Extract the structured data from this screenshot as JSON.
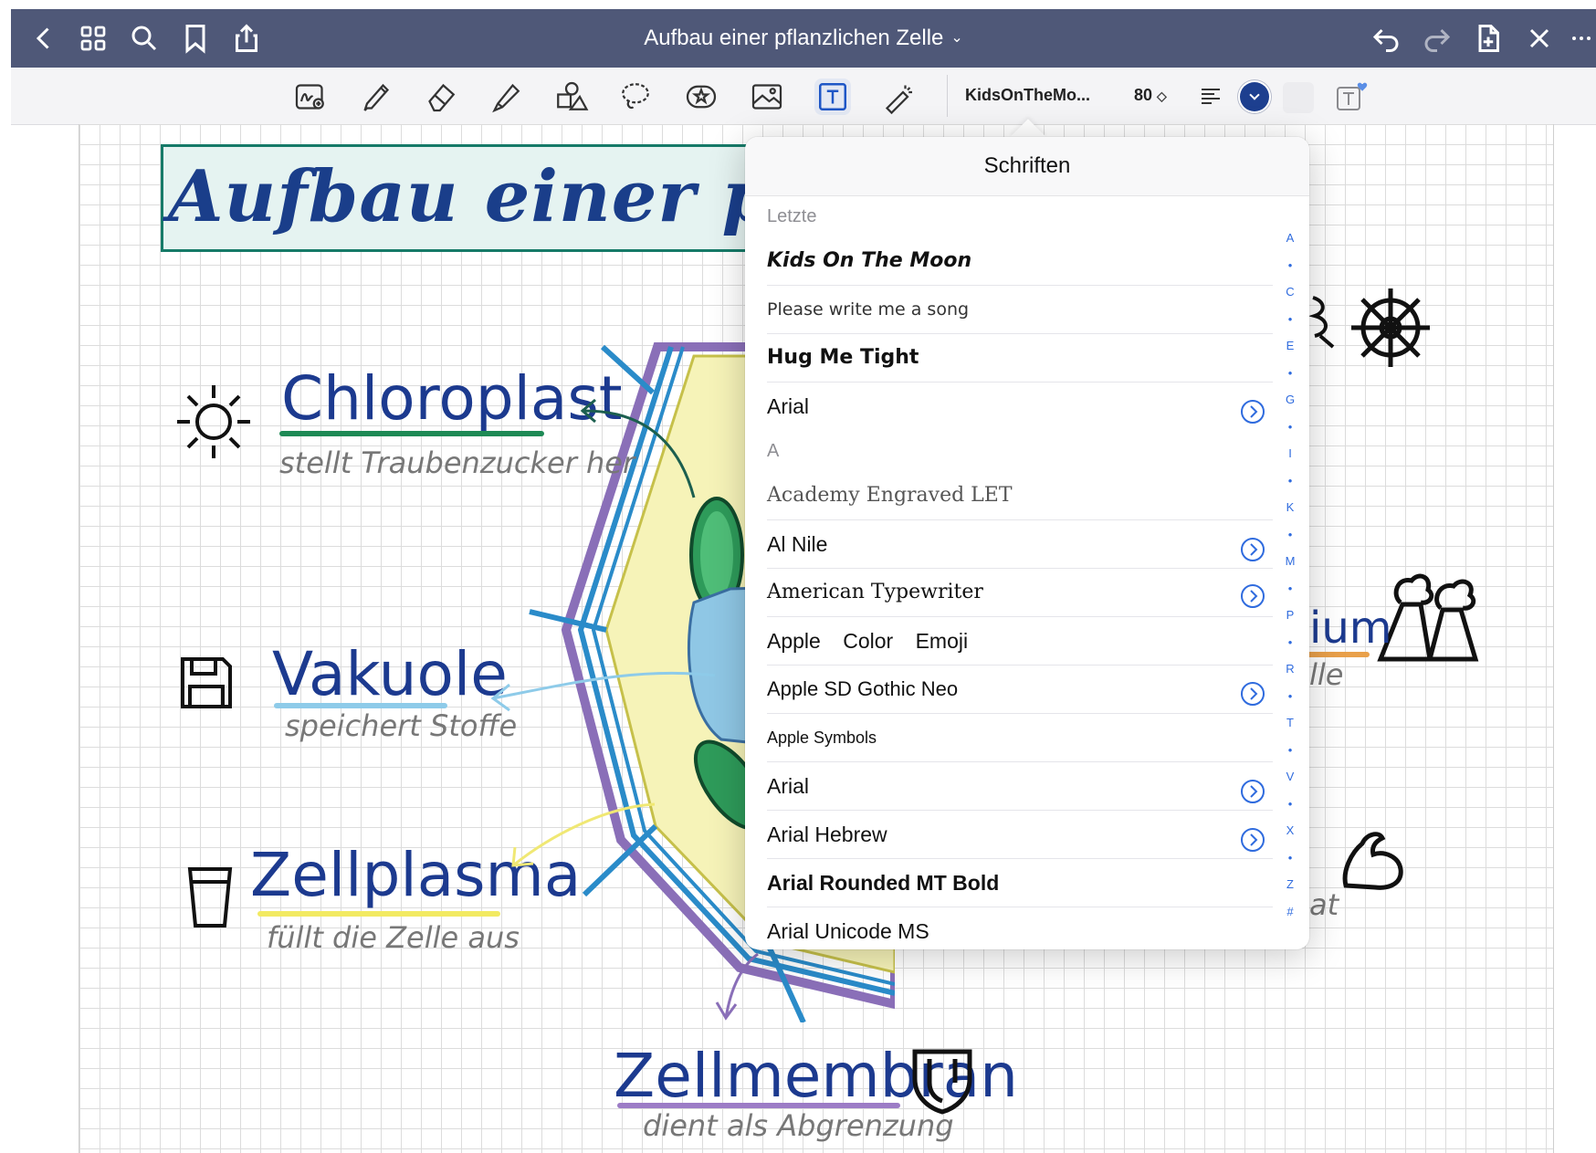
{
  "topbar": {
    "title": "Aufbau einer pflanzlichen Zelle",
    "title_chevron": "⌄",
    "left_icons": [
      "back-chevron-icon",
      "grid-icon",
      "search-icon",
      "bookmark-icon",
      "share-icon"
    ],
    "right_icons": [
      "undo-icon",
      "redo-icon",
      "add-page-icon",
      "close-icon",
      "more-icon"
    ]
  },
  "toolbar": {
    "tools": [
      "handwriting-zoom-icon",
      "pen-icon",
      "eraser-icon",
      "highlighter-icon",
      "shapes-icon",
      "lasso-icon",
      "elements-icon",
      "image-icon",
      "text-tool-icon",
      "laser-pointer-icon"
    ],
    "font_name": "KidsOnTheMo...",
    "font_size": "80",
    "size_stepper": "◇",
    "color": "#1d3f8f"
  },
  "canvas": {
    "note_title": "Aufbau einer pfla",
    "labels": [
      {
        "title": "Chloroplast",
        "subtitle": "stellt Traubenzucker her"
      },
      {
        "title": "Vakuole",
        "subtitle": "speichert Stoffe"
      },
      {
        "title": "Zellplasma",
        "subtitle": "füllt die Zelle aus"
      },
      {
        "title": "Zellmembran",
        "subtitle": "dient als Abgrenzung"
      }
    ],
    "partial_right": [
      "ium",
      "lle",
      "at"
    ]
  },
  "font_picker": {
    "title": "Schriften",
    "recent_header": "Letzte",
    "recent": [
      {
        "name": "Kids On The Moon",
        "info": false
      },
      {
        "name": "Please write me a song",
        "info": false
      },
      {
        "name": "Hug Me Tight",
        "info": false
      },
      {
        "name": "Arial",
        "info": true
      }
    ],
    "section_a": "A",
    "fonts": [
      {
        "name": "Academy Engraved LET",
        "info": false
      },
      {
        "name": "Al Nile",
        "info": true
      },
      {
        "name": "American Typewriter",
        "info": true
      },
      {
        "name": "Apple Color Emoji",
        "info": false
      },
      {
        "name": "Apple SD Gothic Neo",
        "info": true
      },
      {
        "name": "Apple Symbols",
        "info": false
      },
      {
        "name": "Arial",
        "info": true
      },
      {
        "name": "Arial Hebrew",
        "info": true
      },
      {
        "name": "Arial Rounded MT Bold",
        "info": false
      },
      {
        "name": "Arial Unicode MS",
        "info": false
      }
    ],
    "index": [
      "A",
      "•",
      "C",
      "•",
      "E",
      "•",
      "G",
      "•",
      "I",
      "•",
      "K",
      "•",
      "M",
      "•",
      "P",
      "•",
      "R",
      "•",
      "T",
      "•",
      "V",
      "•",
      "X",
      "•",
      "Z",
      "#"
    ]
  }
}
